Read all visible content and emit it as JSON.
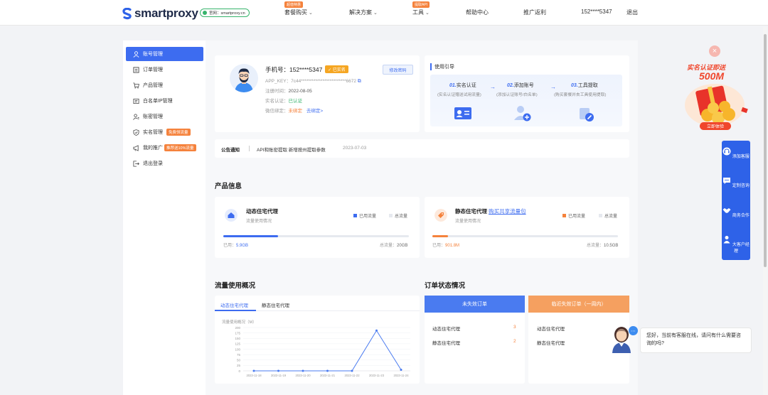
{
  "brand": {
    "name": "smartproxy",
    "site_label": "官网：smartproxy.cn"
  },
  "nav": {
    "items": [
      {
        "label": "套餐购买",
        "tag": "超值特惠",
        "has_caret": true
      },
      {
        "label": "解决方案",
        "tag": "",
        "has_caret": true
      },
      {
        "label": "工具",
        "tag": "提取API",
        "has_caret": true
      },
      {
        "label": "帮助中心",
        "tag": "",
        "has_caret": false
      },
      {
        "label": "推广返利",
        "tag": "",
        "has_caret": false
      }
    ],
    "user_phone": "152****5347",
    "logout": "退出"
  },
  "sidebar": {
    "items": [
      {
        "label": "账号管理",
        "icon": "user-icon",
        "active": true,
        "badge": ""
      },
      {
        "label": "订单管理",
        "icon": "order-icon",
        "active": false,
        "badge": ""
      },
      {
        "label": "产品管理",
        "icon": "cart-icon",
        "active": false,
        "badge": ""
      },
      {
        "label": "白名单IP管理",
        "icon": "list-icon",
        "active": false,
        "badge": ""
      },
      {
        "label": "账密管理",
        "icon": "user-key-icon",
        "active": false,
        "badge": ""
      },
      {
        "label": "实名管理",
        "icon": "shield-icon",
        "active": false,
        "badge": "免费领流量"
      },
      {
        "label": "我的推广",
        "icon": "megaphone-icon",
        "active": false,
        "badge": "推荐送10%流量"
      },
      {
        "label": "退出登录",
        "icon": "exit-icon",
        "active": false,
        "badge": ""
      }
    ]
  },
  "account": {
    "phone_label": "手机号：",
    "phone": "152****5347",
    "verified_label": "已实名",
    "app_key_label": "APP_KEY：",
    "app_key": "7c44*************************6672",
    "register_label": "注册时间：",
    "register_date": "2022-08-05",
    "realname_label": "实名认证：",
    "realname_status": "已认证",
    "wechat_label": "微信绑定：",
    "wechat_status": "未绑定",
    "wechat_link": "去绑定>",
    "edit_password": "修改密码"
  },
  "guide": {
    "title": "使用引导",
    "steps": [
      {
        "num": "01.",
        "title": "实名认证",
        "desc": "(实名认证赠送试用流量)"
      },
      {
        "num": "02.",
        "title": "添加账号",
        "desc": "(添加认证账号/白名单)"
      },
      {
        "num": "03.",
        "title": "工具提取",
        "desc": "(购买套餐并去工具使用提取)"
      }
    ]
  },
  "notice": {
    "tab": "公告通知",
    "text": "API和账密提取 新增按州提取参数",
    "date": "2023-07-03"
  },
  "products": {
    "title": "产品信息",
    "items": [
      {
        "name": "动态住宅代理",
        "buy_link": "",
        "sub": "流量使用情况",
        "legend_used": "已用流量",
        "legend_total": "总流量",
        "used_label": "已用：",
        "used": "5.9GB",
        "total_label": "总流量：",
        "total": "20GB",
        "fill_fraction": 0.295,
        "color": "#3d6cf0"
      },
      {
        "name": "静态住宅代理",
        "buy_link": "购买共享流量包",
        "sub": "流量使用情况",
        "legend_used": "已用流量",
        "legend_total": "总流量",
        "used_label": "已用：",
        "used": "901.8M",
        "total_label": "总流量：",
        "total": "10.5GB",
        "fill_fraction": 0.086,
        "color": "#f5823c"
      }
    ]
  },
  "traffic": {
    "title": "流量使用概况",
    "tabs": [
      "动态住宅代理",
      "静态住宅代理"
    ],
    "active_tab": 0
  },
  "chart_data": {
    "type": "line",
    "title": "流量使用概况（M）",
    "x": [
      "2023-11-18",
      "2023-11-19",
      "2023-11-20",
      "2023-11-21",
      "2023-11-22",
      "2023-11-23",
      "2023-11-24"
    ],
    "series": [
      {
        "values": [
          0,
          0,
          0,
          0,
          0,
          186,
          5
        ]
      }
    ],
    "yticks": [
      0,
      25,
      50,
      75,
      100,
      125,
      150,
      175,
      200
    ],
    "ylim": [
      0,
      200
    ],
    "grid": true,
    "color": "#4a7bf0"
  },
  "orders": {
    "title": "订单状态情况",
    "columns": [
      {
        "header": "未失效订单",
        "color": "#4a7bf0",
        "rows": [
          {
            "label": "动态住宅代理",
            "count": "3"
          },
          {
            "label": "静态住宅代理",
            "count": "2"
          }
        ]
      },
      {
        "header": "临近失效订单（一周内）",
        "color": "#f5a060",
        "rows": [
          {
            "label": "动态住宅代理",
            "count": ""
          },
          {
            "label": "静态住宅代理",
            "count": ""
          }
        ]
      }
    ]
  },
  "promo": {
    "title": "实名认证即送",
    "amount": "500M",
    "cta": "立即体验"
  },
  "tools": [
    {
      "label": "添加客服",
      "icon": "headset-icon"
    },
    {
      "label": "定制咨询",
      "icon": "chat-icon"
    },
    {
      "label": "商务合作",
      "icon": "handshake-icon"
    },
    {
      "label": "大客户经理",
      "icon": "manager-icon"
    }
  ],
  "chat": {
    "message": "您好，当前有客服在线，请问有什么需要咨询的吗?"
  }
}
